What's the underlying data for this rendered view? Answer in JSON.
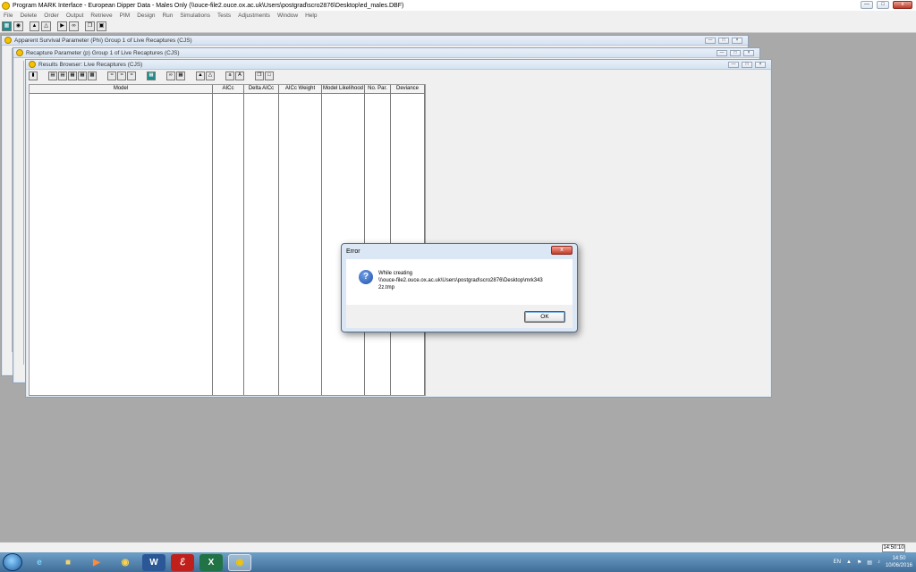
{
  "window": {
    "title": "Program MARK Interface - European Dipper Data - Males Only  (\\\\ouce-file2.ouce.ox.ac.uk\\Users\\postgrad\\scro2876\\Desktop\\ed_males.DBF)",
    "close_symbol": "x"
  },
  "menu": [
    "File",
    "Delete",
    "Order",
    "Output",
    "Retrieve",
    "PIM",
    "Design",
    "Run",
    "Simulations",
    "Tests",
    "Adjustments",
    "Window",
    "Help"
  ],
  "children": {
    "survival_title": "Apparent Survival Parameter (Phi) Group 1 of Live Recaptures (CJS)",
    "recapture_title": "Recapture Parameter (p) Group 1 of Live Recaptures (CJS)",
    "results_title": "Results Browser: Live Recaptures (CJS)"
  },
  "results_table": {
    "columns": [
      "Model",
      "AICc",
      "Delta AICc",
      "AICc Weight",
      "Model Likelihood",
      "No. Par.",
      "Deviance"
    ]
  },
  "error_dialog": {
    "title": "Error",
    "close_symbol": "x",
    "icon_glyph": "?",
    "line1": "While creating",
    "line2": "\\\\\\ouce-file2.ouce.ox.ac.uk\\Users\\postgrad\\scro2876\\Desktop\\mrk343",
    "line3": "2z.tmp",
    "ok_label": "OK"
  },
  "status_clock": "14:50:10",
  "taskbar": {
    "language": "EN",
    "time": "14:50",
    "date": "10/06/2016"
  }
}
